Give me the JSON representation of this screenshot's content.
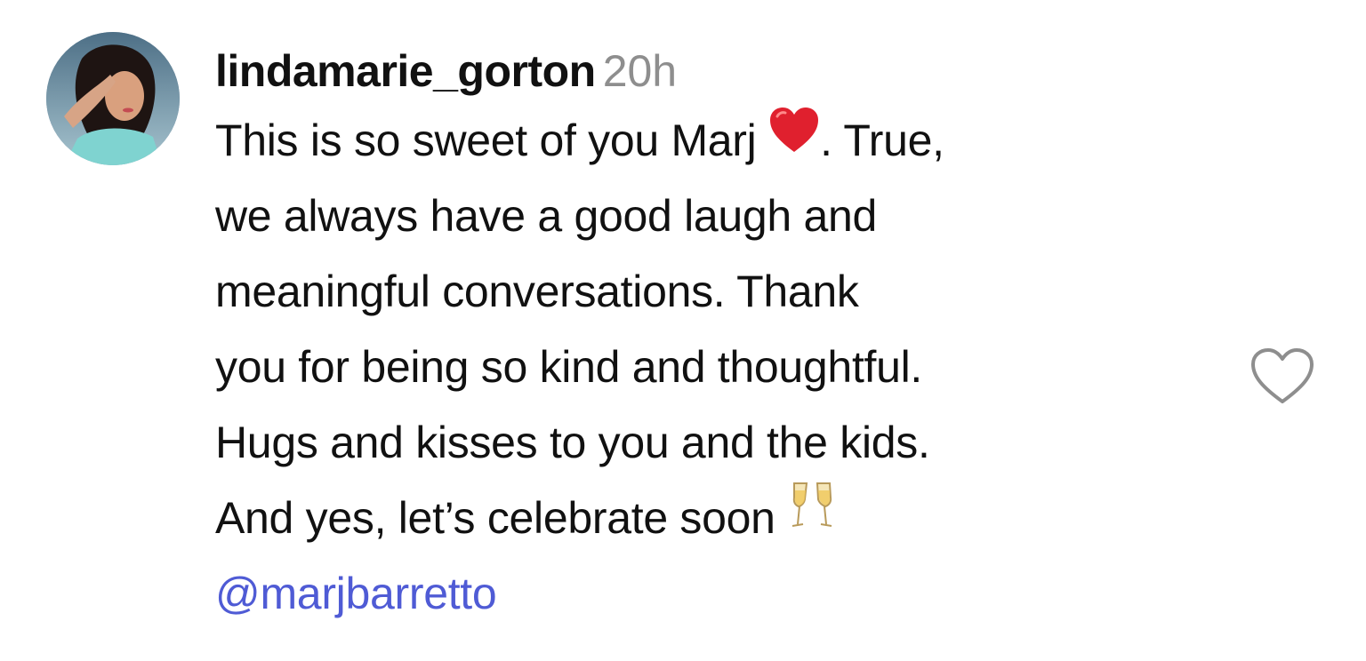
{
  "comment": {
    "username": "lindamarie_gorton",
    "time": "20h",
    "lines": [
      {
        "before": "This is so sweet of you Marj ",
        "emoji": "red-heart",
        "after": ". True,"
      },
      {
        "text": "we always have a good laugh and"
      },
      {
        "text": "meaningful conversations. Thank"
      },
      {
        "text": "you for being so kind and thoughtful."
      },
      {
        "text": "Hugs and kisses to you and the kids."
      },
      {
        "before": "And yes, let’s celebrate soon ",
        "emoji": "champagne-glasses"
      }
    ],
    "mention": "@marjbarretto",
    "like_icon": "heart-outline-icon",
    "colors": {
      "text": "#111111",
      "time": "#8e8e8e",
      "mention": "#4f5bd5",
      "heart_emoji": "#e0202e",
      "like_icon": "#8e8e8e"
    }
  }
}
